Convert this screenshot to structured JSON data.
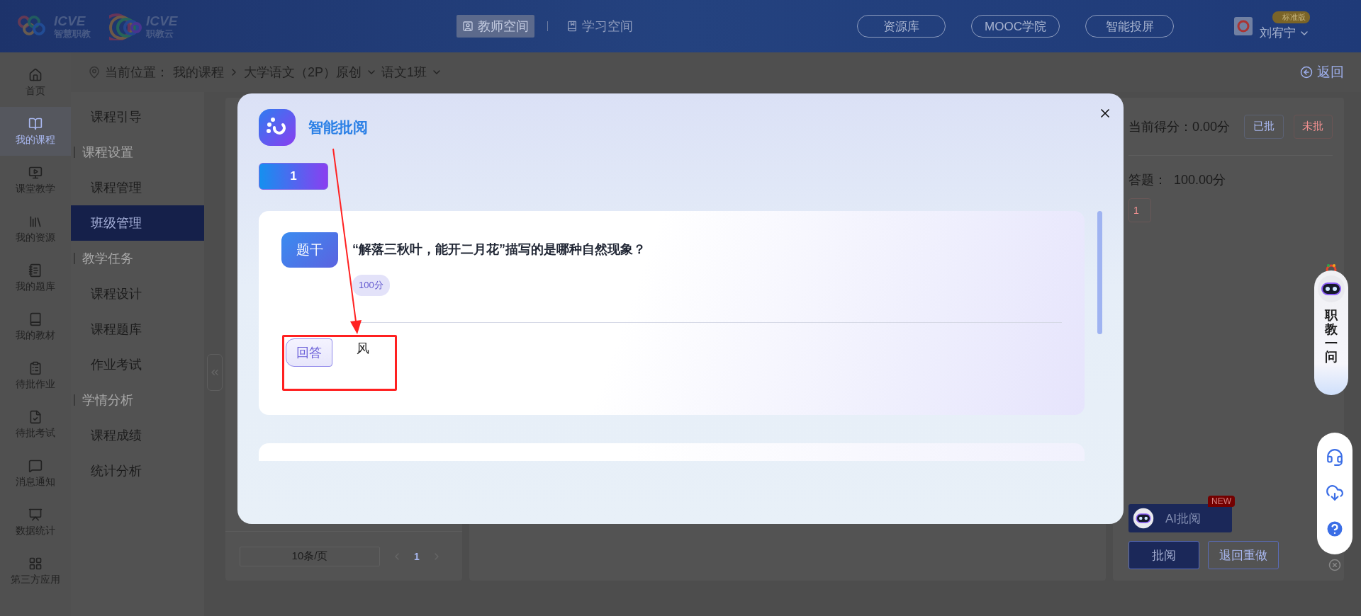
{
  "top_bar": {
    "logos": [
      {
        "brand": "ICVE",
        "tagline": "智慧职教"
      },
      {
        "brand": "ICVE",
        "tagline": "职教云"
      }
    ],
    "spaces": [
      {
        "label": "教师空间",
        "selected": true
      },
      {
        "label": "学习空间",
        "selected": false
      }
    ],
    "links": [
      "资源库",
      "MOOC学院",
      "智能投屏"
    ],
    "user": {
      "badge": "标准版",
      "name": "刘宥宁"
    }
  },
  "nav": [
    {
      "label": "首页",
      "selected": false
    },
    {
      "label": "我的课程",
      "selected": true
    },
    {
      "label": "课堂教学",
      "selected": false
    },
    {
      "label": "我的资源",
      "selected": false
    },
    {
      "label": "我的题库",
      "selected": false
    },
    {
      "label": "我的教材",
      "selected": false
    },
    {
      "label": "待批作业",
      "selected": false
    },
    {
      "label": "待批考试",
      "selected": false
    },
    {
      "label": "消息通知",
      "selected": false
    },
    {
      "label": "数据统计",
      "selected": false
    },
    {
      "label": "第三方应用",
      "selected": false
    }
  ],
  "breadcrumb": {
    "prefix": "当前位置：",
    "items": [
      {
        "label": "我的课程",
        "kind": "link"
      },
      {
        "label": "大学语文（2P）原创",
        "kind": "dropdown"
      },
      {
        "label": "语文1班",
        "kind": "dropdown"
      }
    ],
    "back": "返回"
  },
  "sidebar": [
    {
      "kind": "item",
      "label": "课程引导",
      "selected": false
    },
    {
      "kind": "group",
      "label": "课程设置"
    },
    {
      "kind": "item",
      "label": "课程管理",
      "selected": false
    },
    {
      "kind": "item",
      "label": "班级管理",
      "selected": true
    },
    {
      "kind": "group",
      "label": "教学任务"
    },
    {
      "kind": "item",
      "label": "课程设计",
      "selected": false
    },
    {
      "kind": "item",
      "label": "课程题库",
      "selected": false
    },
    {
      "kind": "item",
      "label": "作业考试",
      "selected": false
    },
    {
      "kind": "group",
      "label": "学情分析"
    },
    {
      "kind": "item",
      "label": "课程成绩",
      "selected": false
    },
    {
      "kind": "item",
      "label": "统计分析",
      "selected": false
    }
  ],
  "list_panel": {
    "page_size": "10条/页",
    "pages": [
      {
        "label": "1",
        "selected": true
      }
    ]
  },
  "grading_panel": {
    "score": "当前得分：0.00分",
    "filters": [
      {
        "label": "已批",
        "kind": "graded"
      },
      {
        "label": "未批",
        "kind": "ungraded"
      }
    ],
    "section": "答题：  100.00分",
    "questions": [
      {
        "label": "1"
      }
    ],
    "ai_button": {
      "label": "AI批阅",
      "badge": "NEW"
    },
    "actions": [
      {
        "label": "批阅",
        "kind": "primary"
      },
      {
        "label": "退回重做",
        "kind": "outline"
      }
    ]
  },
  "assistant": {
    "label": "职教一问"
  },
  "modal": {
    "title": "智能批阅",
    "tabs": [
      {
        "label": "1",
        "selected": true
      }
    ],
    "question": {
      "stem_label": "题干",
      "text": "“解落三秋叶，能开二月花”描写的是哪种自然现象？",
      "points": "100分",
      "answer_label": "回答",
      "answer": "风"
    }
  }
}
